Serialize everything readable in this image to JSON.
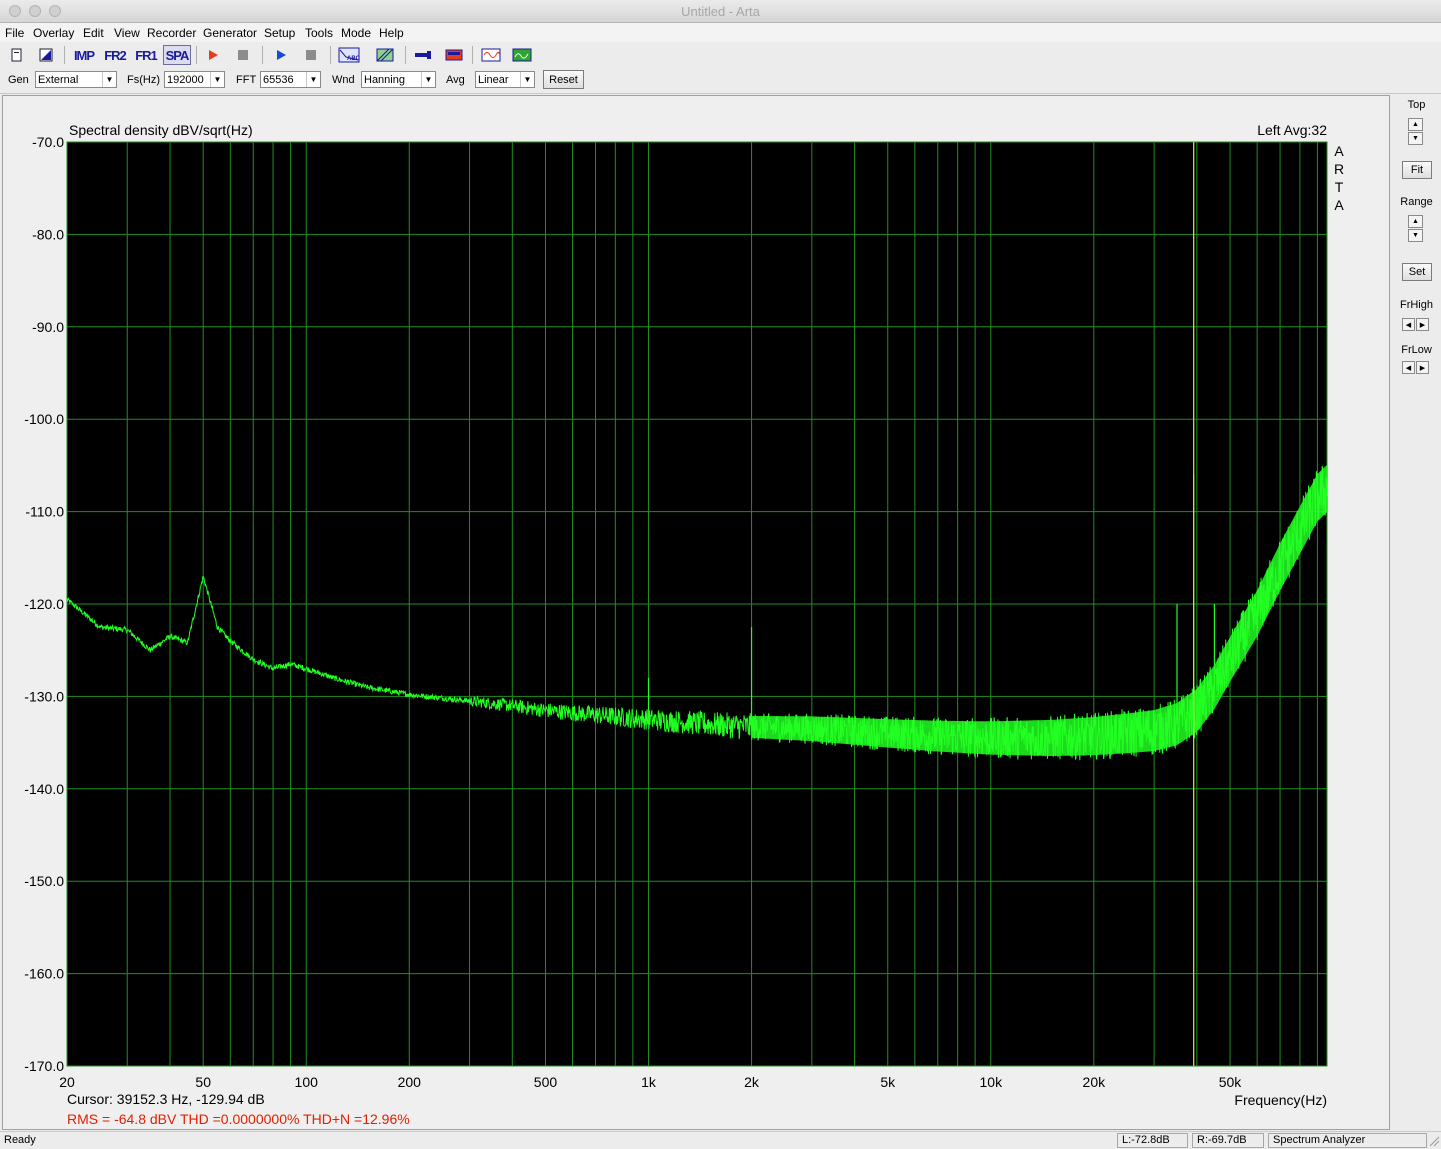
{
  "window": {
    "title": "Untitled - Arta"
  },
  "menu": [
    "File",
    "Overlay",
    "Edit",
    "View",
    "Recorder",
    "Generator",
    "Setup",
    "Tools",
    "Mode",
    "Help"
  ],
  "toolbar": {
    "imp_label": "IMP",
    "fr2_label": "FR2",
    "fr1_label": "FR1",
    "spa_label": "SPA"
  },
  "controls": {
    "gen_label": "Gen",
    "gen_value": "External",
    "fs_label": "Fs(Hz)",
    "fs_value": "192000",
    "fft_label": "FFT",
    "fft_value": "65536",
    "wnd_label": "Wnd",
    "wnd_value": "Hanning",
    "avg_label": "Avg",
    "avg_value": "Linear",
    "reset_label": "Reset"
  },
  "right_panel": {
    "top_label": "Top",
    "fit_label": "Fit",
    "range_label": "Range",
    "set_label": "Set",
    "frhigh_label": "FrHigh",
    "frlow_label": "FrLow"
  },
  "plot": {
    "brand": "A R T A",
    "cursor_text": "Cursor: 39152.3 Hz, -129.94 dB",
    "rms_text": "RMS =  -64.8 dBV   THD =0.0000000%   THD+N =12.96%",
    "cursor_freq_hz": 39152.3
  },
  "status": {
    "ready": "Ready",
    "left_level": "L:-72.8dB",
    "right_level": "R:-69.7dB",
    "mode": "Spectrum Analyzer"
  },
  "colors": {
    "plot_bg": "#000000",
    "grid": "#1f8f1f",
    "trace": "#22ff22",
    "cursor": "#d9d93a",
    "info": "#e02000"
  },
  "chart_data": {
    "type": "line",
    "title": "Spectral density dBV/sqrt(Hz)",
    "legend": "Left  Avg:32",
    "xlabel": "Frequency(Hz)",
    "ylabel": "",
    "xscale": "log",
    "xlim": [
      20,
      96000
    ],
    "ylim": [
      -170,
      -70
    ],
    "yticks": [
      -70,
      -80,
      -90,
      -100,
      -110,
      -120,
      -130,
      -140,
      -150,
      -160,
      -170
    ],
    "ytick_labels": [
      "-70.0",
      "-80.0",
      "-90.0",
      "-100.0",
      "-110.0",
      "-120.0",
      "-130.0",
      "-140.0",
      "-150.0",
      "-160.0",
      "-170.0"
    ],
    "xticks": [
      20,
      50,
      100,
      200,
      500,
      1000,
      2000,
      5000,
      10000,
      20000,
      50000
    ],
    "xtick_labels": [
      "20",
      "50",
      "100",
      "200",
      "500",
      "1k",
      "2k",
      "5k",
      "10k",
      "20k",
      "50k"
    ],
    "series": [
      {
        "x": [
          20,
          25,
          30,
          35,
          40,
          45,
          50,
          55,
          60,
          70,
          80,
          90,
          100,
          120,
          150,
          200,
          300,
          400,
          500,
          700,
          1000,
          1500,
          2000,
          3000,
          5000,
          7000,
          10000,
          15000,
          20000,
          25000,
          30000,
          35000,
          40000,
          45000,
          50000,
          60000,
          70000,
          80000,
          90000,
          96000
        ],
        "y": [
          -119.5,
          -122.5,
          -122.8,
          -125.0,
          -123.5,
          -124.2,
          -117.0,
          -122.5,
          -124.0,
          -126.0,
          -127.0,
          -126.5,
          -127.0,
          -128.0,
          -129.0,
          -129.8,
          -130.5,
          -131.0,
          -131.5,
          -132.0,
          -132.5,
          -133.0,
          -133.3,
          -133.5,
          -134.0,
          -134.3,
          -134.5,
          -134.5,
          -134.3,
          -134.0,
          -133.7,
          -133.0,
          -131.5,
          -129.0,
          -126.0,
          -121.0,
          -116.0,
          -112.0,
          -108.5,
          -107.5
        ],
        "spikes": [
          [
            50,
            -117.0
          ],
          [
            2000,
            -122.5
          ],
          [
            1000,
            -128.0
          ],
          [
            39152.3,
            -106.0
          ],
          [
            35000,
            -120.0
          ],
          [
            45000,
            -120.0
          ]
        ]
      }
    ]
  }
}
